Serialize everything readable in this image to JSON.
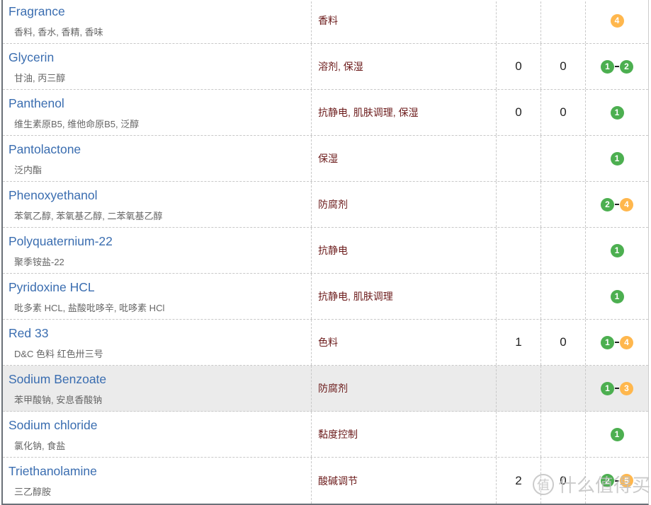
{
  "colors": {
    "green": "#4caf50",
    "orange": "#ffb74d",
    "name": "#3a6db0",
    "function": "#6b1a1a"
  },
  "rows": [
    {
      "name": "Fragrance",
      "aliases": "香料, 香水, 香精, 香味",
      "function": "香料",
      "v1": "",
      "v2": "",
      "rating": [
        {
          "n": "4",
          "c": "orange"
        }
      ]
    },
    {
      "name": "Glycerin",
      "aliases": "甘油, 丙三醇",
      "function": "溶剂, 保湿",
      "v1": "0",
      "v2": "0",
      "rating": [
        {
          "n": "1",
          "c": "green"
        },
        {
          "n": "2",
          "c": "green"
        }
      ]
    },
    {
      "name": "Panthenol",
      "aliases": "维生素原B5, 维他命原B5, 泛醇",
      "function": "抗静电, 肌肤调理, 保湿",
      "v1": "0",
      "v2": "0",
      "rating": [
        {
          "n": "1",
          "c": "green"
        }
      ]
    },
    {
      "name": "Pantolactone",
      "aliases": "泛内酯",
      "function": "保湿",
      "v1": "",
      "v2": "",
      "rating": [
        {
          "n": "1",
          "c": "green"
        }
      ]
    },
    {
      "name": "Phenoxyethanol",
      "aliases": "苯氧乙醇, 苯氧基乙醇, 二苯氧基乙醇",
      "function": "防腐剂",
      "v1": "",
      "v2": "",
      "rating": [
        {
          "n": "2",
          "c": "green"
        },
        {
          "n": "4",
          "c": "orange"
        }
      ]
    },
    {
      "name": "Polyquaternium-22",
      "aliases": "聚季铵盐-22",
      "function": "抗静电",
      "v1": "",
      "v2": "",
      "rating": [
        {
          "n": "1",
          "c": "green"
        }
      ]
    },
    {
      "name": "Pyridoxine HCL",
      "aliases": "吡多素 HCL, 盐酸吡哆辛, 吡哆素 HCl",
      "function": "抗静电, 肌肤调理",
      "v1": "",
      "v2": "",
      "rating": [
        {
          "n": "1",
          "c": "green"
        }
      ]
    },
    {
      "name": "Red 33",
      "aliases": "D&C 色料 红色卅三号",
      "function": "色料",
      "v1": "1",
      "v2": "0",
      "rating": [
        {
          "n": "1",
          "c": "green"
        },
        {
          "n": "4",
          "c": "orange"
        }
      ]
    },
    {
      "name": "Sodium Benzoate",
      "aliases": "苯甲酸钠, 安息香酸钠",
      "function": "防腐剂",
      "v1": "",
      "v2": "",
      "rating": [
        {
          "n": "1",
          "c": "green"
        },
        {
          "n": "3",
          "c": "orange"
        }
      ],
      "highlighted": true
    },
    {
      "name": "Sodium chloride",
      "aliases": "氯化钠, 食盐",
      "function": "黏度控制",
      "v1": "",
      "v2": "",
      "rating": [
        {
          "n": "1",
          "c": "green"
        }
      ]
    },
    {
      "name": "Triethanolamine",
      "aliases": "三乙醇胺",
      "function": "酸碱调节",
      "v1": "2",
      "v2": "0",
      "rating": [
        {
          "n": "2",
          "c": "green"
        },
        {
          "n": "5",
          "c": "orange"
        }
      ]
    }
  ],
  "watermark": {
    "mark": "值",
    "text": "什么值得买"
  }
}
